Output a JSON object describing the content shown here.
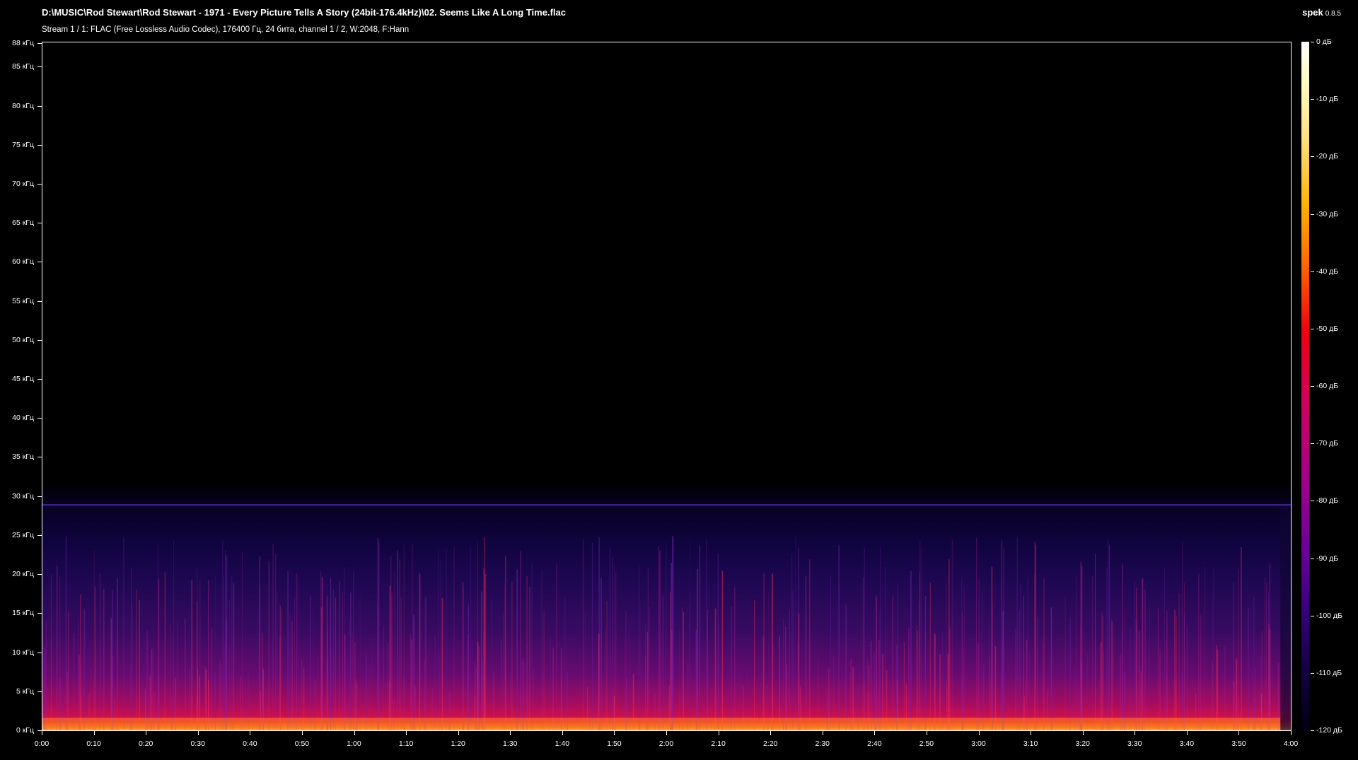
{
  "header": {
    "file_path": "D:\\MUSIC\\Rod Stewart\\Rod Stewart - 1971 - Every Picture Tells A Story (24bit-176.4kHz)\\02. Seems Like A Long Time.flac",
    "stream_info": "Stream 1 / 1: FLAC (Free Lossless Audio Codec), 176400 Гц, 24 бита, channel 1 / 2, W:2048, F:Hann",
    "app_name": "spek",
    "app_version": "0.8.5"
  },
  "colors": {
    "background": "#000000",
    "text": "#ffffff",
    "cutoff_line": "#5a2bd6"
  },
  "spectrogram": {
    "frequency_ticks": [
      {
        "khz": 88,
        "label": "88 кГц"
      },
      {
        "khz": 85,
        "label": "85 кГц"
      },
      {
        "khz": 80,
        "label": "80 кГц"
      },
      {
        "khz": 75,
        "label": "75 кГц"
      },
      {
        "khz": 70,
        "label": "70 кГц"
      },
      {
        "khz": 65,
        "label": "65 кГц"
      },
      {
        "khz": 60,
        "label": "60 кГц"
      },
      {
        "khz": 55,
        "label": "55 кГц"
      },
      {
        "khz": 50,
        "label": "50 кГц"
      },
      {
        "khz": 45,
        "label": "45 кГц"
      },
      {
        "khz": 40,
        "label": "40 кГц"
      },
      {
        "khz": 35,
        "label": "35 кГц"
      },
      {
        "khz": 30,
        "label": "30 кГц"
      },
      {
        "khz": 25,
        "label": "25 кГц"
      },
      {
        "khz": 20,
        "label": "20 кГц"
      },
      {
        "khz": 15,
        "label": "15 кГц"
      },
      {
        "khz": 10,
        "label": "10 кГц"
      },
      {
        "khz": 5,
        "label": "5 кГц"
      },
      {
        "khz": 0,
        "label": "0 кГц"
      }
    ],
    "time_ticks": [
      "0:00",
      "0:10",
      "0:20",
      "0:30",
      "0:40",
      "0:50",
      "1:00",
      "1:10",
      "1:20",
      "1:30",
      "1:40",
      "1:50",
      "2:00",
      "2:10",
      "2:20",
      "2:30",
      "2:40",
      "2:50",
      "3:00",
      "3:10",
      "3:20",
      "3:30",
      "3:40",
      "3:50",
      "4:00"
    ],
    "max_frequency_khz": 88.2,
    "duration_seconds": 240,
    "cutoff_khz": 28.9,
    "content_end_seconds": 238
  },
  "level_scale": {
    "ticks": [
      {
        "db": 0,
        "label": "0 дБ"
      },
      {
        "db": -10,
        "label": "-10 дБ"
      },
      {
        "db": -20,
        "label": "-20 дБ"
      },
      {
        "db": -30,
        "label": "-30 дБ"
      },
      {
        "db": -40,
        "label": "-40 дБ"
      },
      {
        "db": -50,
        "label": "-50 дБ"
      },
      {
        "db": -60,
        "label": "-60 дБ"
      },
      {
        "db": -70,
        "label": "-70 дБ"
      },
      {
        "db": -80,
        "label": "-80 дБ"
      },
      {
        "db": -90,
        "label": "-90 дБ"
      },
      {
        "db": -100,
        "label": "-100 дБ"
      },
      {
        "db": -110,
        "label": "-110 дБ"
      },
      {
        "db": -120,
        "label": "-120 дБ"
      }
    ],
    "min_db": -120,
    "max_db": 0
  }
}
